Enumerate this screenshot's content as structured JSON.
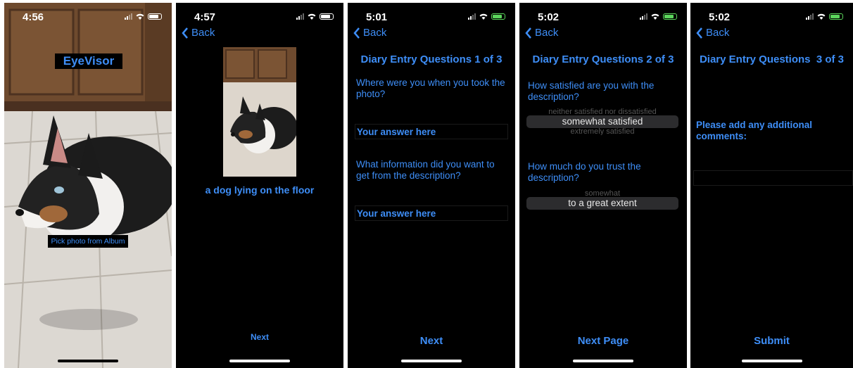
{
  "screens": [
    {
      "time": "4:56",
      "app_title": "EyeVisor",
      "pick_button": "Pick photo from Album"
    },
    {
      "time": "4:57",
      "back_label": "Back",
      "caption": "a dog lying on the floor",
      "next_label": "Next"
    },
    {
      "time": "5:01",
      "back_label": "Back",
      "title": "Diary Entry Questions 1 of 3",
      "q1": "Where were you when you took the photo?",
      "q1_answer": "Your answer here",
      "q2": "What information did you want to get from the description?",
      "q2_answer": "Your answer here",
      "next_label": "Next"
    },
    {
      "time": "5:02",
      "back_label": "Back",
      "title": "Diary Entry Questions 2 of 3",
      "q1": "How satisfied are you with the description?",
      "q1_above": "neither satisfied nor dissatisfied",
      "q1_selected": "somewhat satisfied",
      "q1_below": "extremely satisfied",
      "q2": "How much do you trust the description?",
      "q2_above": "somewhat",
      "q2_selected": "to a great extent",
      "next_label": "Next Page"
    },
    {
      "time": "5:02",
      "back_label": "Back",
      "title": "Diary Entry Questions  3 of 3",
      "prompt": "Please add any additional comments:",
      "submit_label": "Submit"
    }
  ],
  "colors": {
    "accent": "#3e8ef7",
    "background": "#000000",
    "charging": "#5cd65c"
  },
  "icons": [
    "chevron-left-icon",
    "signal-icon",
    "wifi-icon",
    "battery-icon"
  ]
}
